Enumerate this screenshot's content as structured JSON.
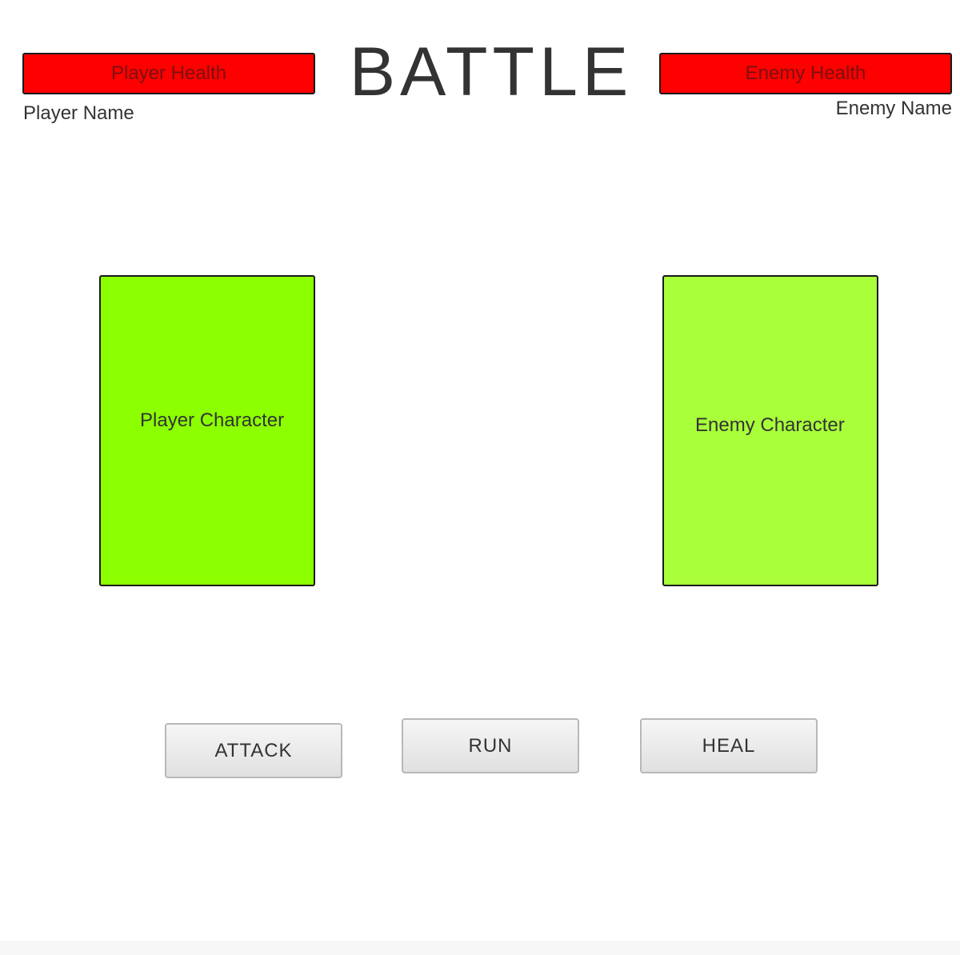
{
  "title": "BATTLE",
  "player": {
    "health_label": "Player Health",
    "name": "Player Name",
    "character_label": "Player Character",
    "health_color": "#ff0000",
    "character_color": "#8cff00"
  },
  "enemy": {
    "health_label": "Enemy Health",
    "name": "Enemy Name",
    "character_label": "Enemy Character",
    "health_color": "#ff0000",
    "character_color": "#a8ff3a"
  },
  "actions": {
    "attack_label": "ATTACK",
    "run_label": "RUN",
    "heal_label": "HEAL"
  }
}
